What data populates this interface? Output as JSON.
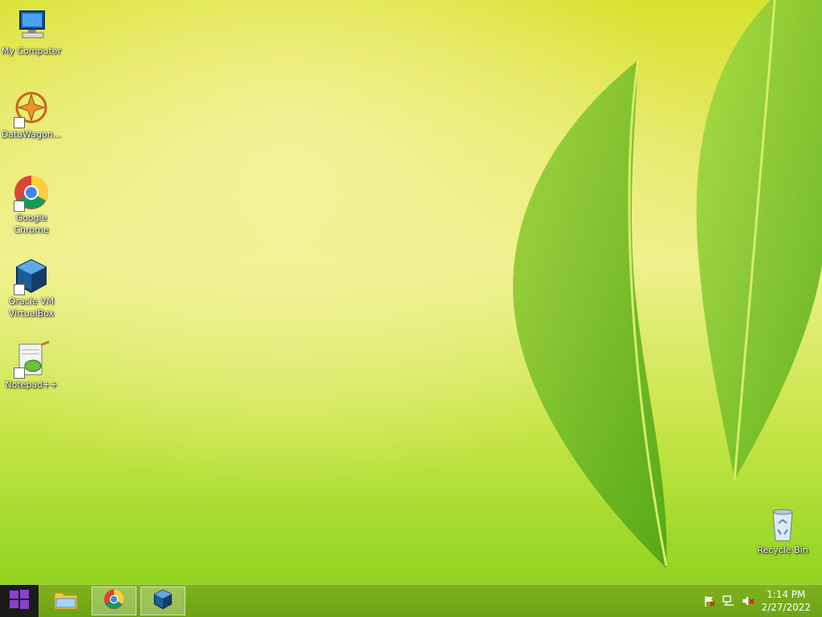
{
  "desktop": {
    "icons": [
      {
        "label": "My Computer",
        "icon": "computer-icon"
      },
      {
        "label": "DataWagon...",
        "icon": "datawagon-icon"
      },
      {
        "label": "Google\nChrome",
        "icon": "chrome-icon"
      },
      {
        "label": "Oracle VM\nVirtualBox",
        "icon": "virtualbox-icon"
      },
      {
        "label": "Notepad++",
        "icon": "notepadpp-icon"
      }
    ],
    "recycle_bin": {
      "label": "Recycle Bin",
      "icon": "recycle-bin-icon"
    }
  },
  "taskbar": {
    "start": {
      "icon": "windows-logo-icon"
    },
    "pinned": [
      {
        "icon": "file-explorer-icon",
        "active": false
      },
      {
        "icon": "chrome-icon",
        "active": true
      },
      {
        "icon": "virtualbox-icon",
        "active": false
      }
    ],
    "tray": {
      "icons": [
        "action-center-flag-icon",
        "network-icon",
        "volume-muted-icon"
      ],
      "time": "1:14 PM",
      "date": "2/27/2022"
    }
  },
  "colors": {
    "taskbar": "#76aa19",
    "start_button": "#1b1b1b",
    "wallpaper_top": "#d7e22b",
    "wallpaper_bottom": "#8fd41e"
  }
}
